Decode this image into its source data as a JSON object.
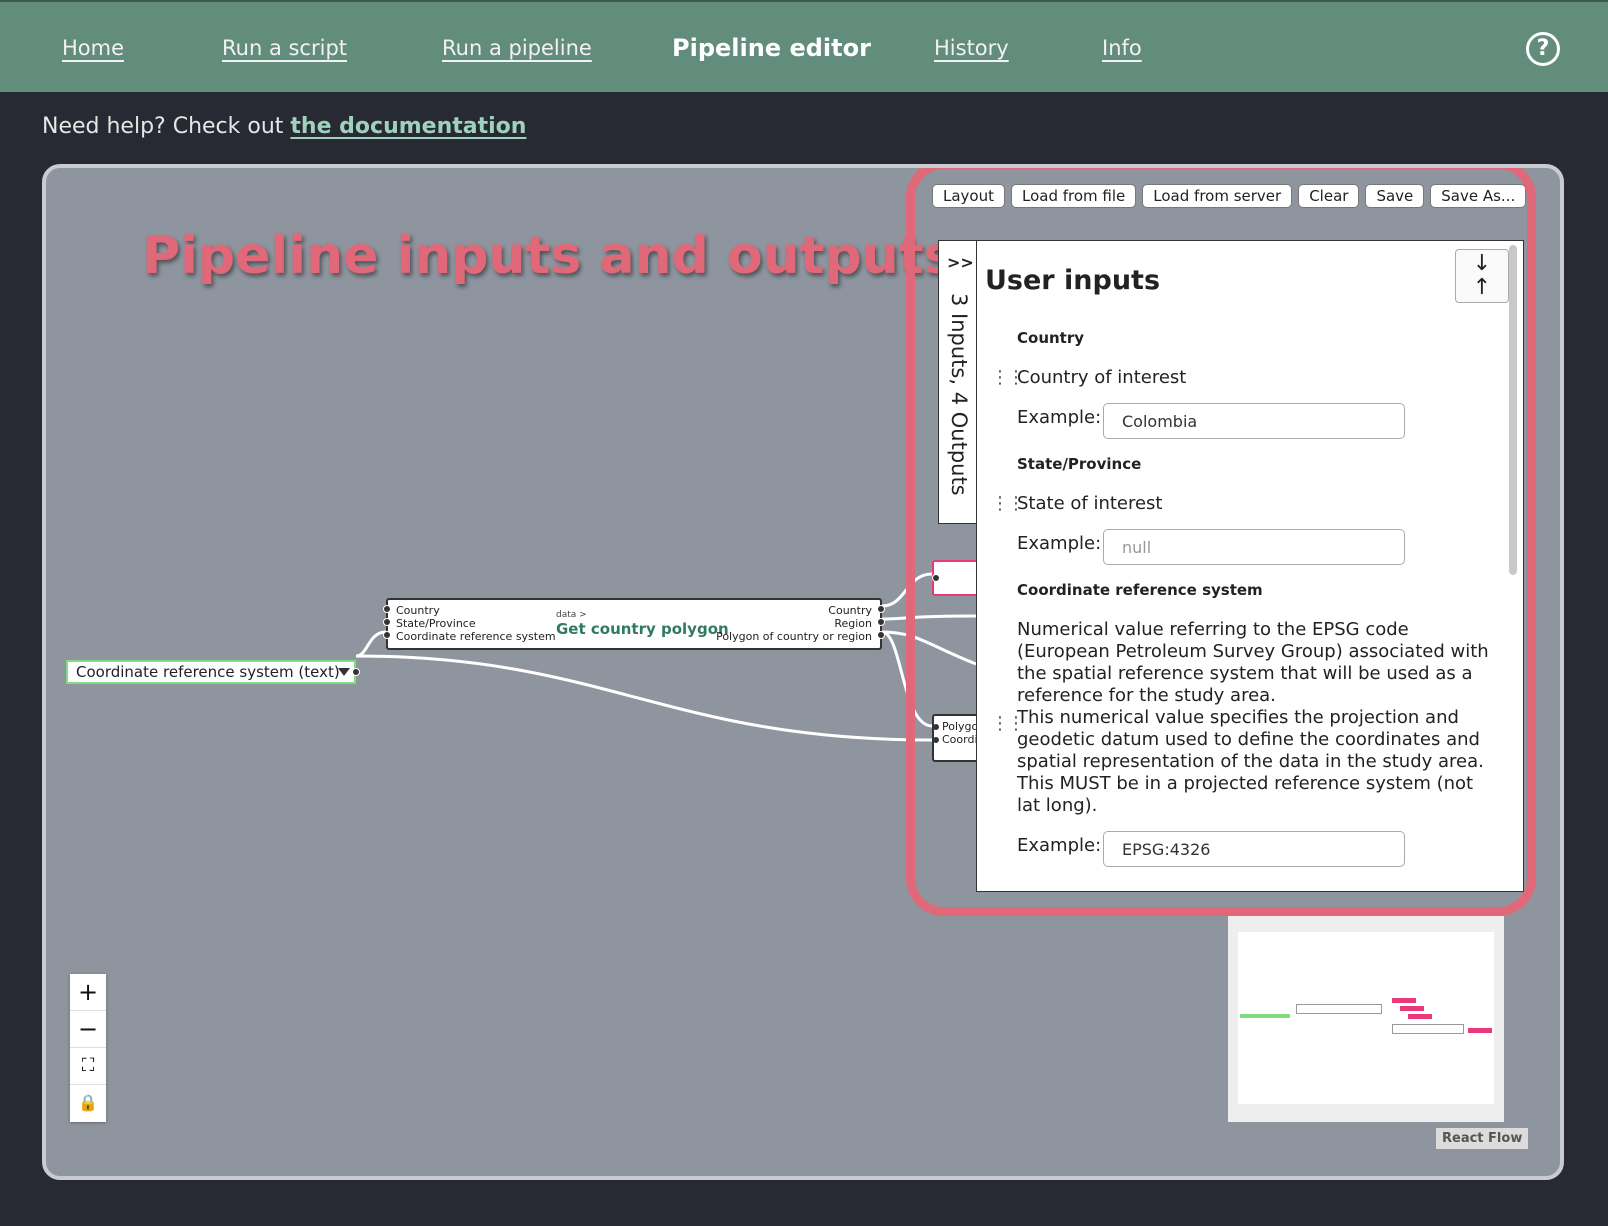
{
  "nav": {
    "home": "Home",
    "run_script": "Run a script",
    "run_pipeline": "Run a pipeline",
    "pipeline_editor": "Pipeline editor",
    "history": "History",
    "info": "Info",
    "help_icon": "?"
  },
  "help_line": {
    "prefix": "Need help? Check out ",
    "link": "the documentation"
  },
  "overlay_title": "Pipeline inputs and outputs",
  "toolbar": {
    "layout": "Layout",
    "load_file": "Load from file",
    "load_server": "Load from server",
    "clear": "Clear",
    "save": "Save",
    "save_as": "Save As..."
  },
  "nodes": {
    "crs_input": "Coordinate reference system (text)",
    "script": {
      "prefix": "data >",
      "title": "Get country polygon",
      "inputs": [
        "Country",
        "State/Province",
        "Coordinate reference system"
      ],
      "outputs": [
        "Country",
        "Region",
        "Polygon of country or region"
      ]
    },
    "partial": [
      "Polygo",
      "Coordi"
    ]
  },
  "io_panel": {
    "expand_chevron": ">>",
    "tab_label": "3 Inputs, 4 Outputs",
    "title": "User inputs",
    "example_label": "Example:",
    "inputs": [
      {
        "name": "Country",
        "description": "Country of interest",
        "example": "Colombia"
      },
      {
        "name": "State/Province",
        "description": "State of interest",
        "example": "null"
      },
      {
        "name": "Coordinate reference system",
        "description": "Numerical value referring to the EPSG code (European Petroleum Survey Group) associated with the spatial reference system that will be used as a reference for the study area.\nThis numerical value specifies the projection and geodetic datum used to define the coordinates and spatial representation of the data in the study area. This MUST be in a projected reference system (not lat long).",
        "example": "EPSG:4326"
      }
    ]
  },
  "controls": {
    "zoom_in": "+",
    "zoom_out": "−",
    "fit_view": "⛶",
    "lock": "🔒"
  },
  "attribution": "React Flow",
  "colors": {
    "nav_bg": "#628c7b",
    "page_bg": "#272a33",
    "canvas_bg": "#8f959f",
    "highlight": "#e06878",
    "input_node_border": "#7edc7e",
    "output_node_border": "#e83a7a",
    "script_title": "#2f7a62"
  }
}
